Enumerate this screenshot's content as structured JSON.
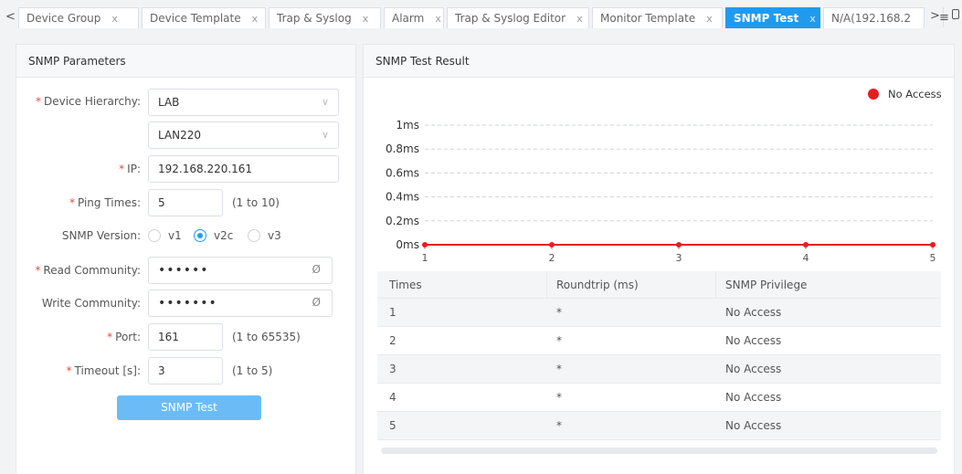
{
  "tabs": [
    {
      "label": "Device Group",
      "close": "x"
    },
    {
      "label": "Device Template",
      "close": "x"
    },
    {
      "label": "Trap & Syslog",
      "close": "x"
    },
    {
      "label": "Alarm",
      "close": "x"
    },
    {
      "label": "Trap & Syslog Editor",
      "close": "x"
    },
    {
      "label": "Monitor Template",
      "close": "x"
    },
    {
      "label": "SNMP Test",
      "close": "x",
      "active": true
    },
    {
      "label": "N/A(192.168.2"
    }
  ],
  "icons": {
    "scroll_left": "chevron-left-icon",
    "scroll_right": "chevron-right-icon",
    "menu": "hamburger-menu-icon",
    "last": "window-icon",
    "eye": "eye-slash-icon"
  },
  "params": {
    "title": "SNMP Parameters",
    "device_hierarchy_label": "Device Hierarchy:",
    "hierarchy_level1": "LAB",
    "hierarchy_level2": "LAN220",
    "ip_label": "IP:",
    "ip_value": "192.168.220.161",
    "ping_label": "Ping Times:",
    "ping_value": "5",
    "ping_hint": "(1 to 10)",
    "version_label": "SNMP Version:",
    "versions": [
      "v1",
      "v2c",
      "v3"
    ],
    "version_selected": "v2c",
    "read_label": "Read Community:",
    "read_value": "••••••",
    "write_label": "Write Community:",
    "write_value": "•••••••",
    "port_label": "Port:",
    "port_value": "161",
    "port_hint": "(1 to 65535)",
    "timeout_label": "Timeout [s]:",
    "timeout_value": "3",
    "timeout_hint": "(1 to 5)",
    "button": "SNMP Test",
    "required_mark": "*"
  },
  "result": {
    "title": "SNMP Test Result",
    "columns": [
      "Times",
      "Roundtrip (ms)",
      "SNMP Privilege"
    ],
    "rows": [
      [
        "1",
        "*",
        "No Access"
      ],
      [
        "2",
        "*",
        "No Access"
      ],
      [
        "3",
        "*",
        "No Access"
      ],
      [
        "4",
        "*",
        "No Access"
      ],
      [
        "5",
        "*",
        "No Access"
      ]
    ]
  },
  "colors": {
    "accent": "#1e9bf0",
    "series": "#e41e1e",
    "required": "#e74c3c"
  },
  "chart_data": {
    "type": "line",
    "x": [
      1,
      2,
      3,
      4,
      5
    ],
    "series": [
      {
        "name": "No Access",
        "values": [
          0,
          0,
          0,
          0,
          0
        ]
      }
    ],
    "y_ticks": [
      "0ms",
      "0.2ms",
      "0.4ms",
      "0.6ms",
      "0.8ms",
      "1ms"
    ],
    "y_tick_values": [
      0,
      0.2,
      0.4,
      0.6,
      0.8,
      1
    ],
    "x_ticks": [
      "1",
      "2",
      "3",
      "4",
      "5"
    ],
    "ylim": [
      0,
      1
    ],
    "xlim": [
      1,
      5
    ],
    "grid": true,
    "legend": "top-right"
  }
}
